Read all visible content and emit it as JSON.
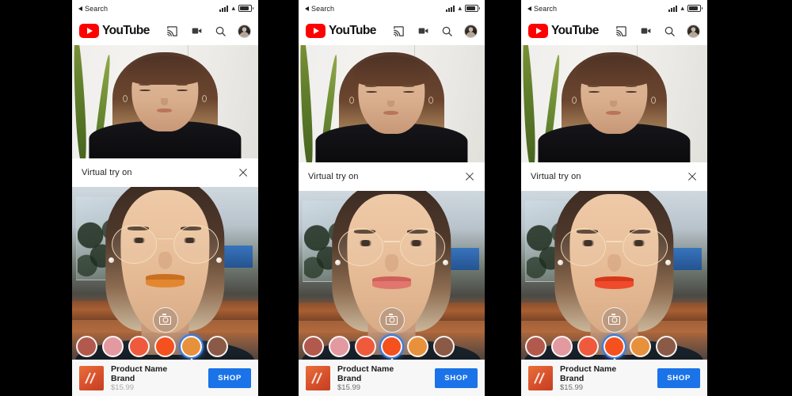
{
  "meta": {
    "background_color": "#000000",
    "accent_blue": "#1a73e8",
    "selection_ring": "#3b7ddd",
    "youtube_red": "#ff0000",
    "panel_count": 3,
    "description": "Three sequential mobile screenshots of a YouTube AR beauty Virtual try on experience"
  },
  "status_bar": {
    "back_label": "Search",
    "signal_icon": "signal-bars-icon",
    "wifi_icon": "wifi-icon",
    "battery_icon": "battery-icon"
  },
  "app_bar": {
    "brand": "YouTube",
    "play_icon": "youtube-play-icon",
    "actions": [
      {
        "name": "cast-icon",
        "label": "Cast"
      },
      {
        "name": "video-camera-icon",
        "label": "Create"
      },
      {
        "name": "search-icon",
        "label": "Search"
      },
      {
        "name": "avatar",
        "label": "Account"
      }
    ]
  },
  "tryon": {
    "title": "Virtual try on",
    "close_icon": "close-icon",
    "shutter_icon": "camera-icon"
  },
  "product": {
    "name": "Product Name",
    "brand": "Brand",
    "price": "$15.99",
    "shop_label": "SHOP",
    "thumb_icon": "lipstick-swatch-thumbnail"
  },
  "swatches": {
    "colors": [
      "#b2594d",
      "#e29aa0",
      "#ef5a3d",
      "#f4511e",
      "#e8913c",
      "#8a5a46"
    ]
  },
  "panels": [
    {
      "id": "panel-1",
      "selected_swatch_index": 4,
      "lip_color": "#e2872f",
      "lip_color_deep": "#c96f20",
      "caption": "Orange shade applied"
    },
    {
      "id": "panel-2",
      "selected_swatch_index": 3,
      "lip_color": "#e1766f",
      "lip_color_deep": "#cf5f58",
      "caption": "Soft coral-pink shade applied"
    },
    {
      "id": "panel-3",
      "selected_swatch_index": 3,
      "lip_color": "#ef4a2c",
      "lip_color_deep": "#d53718",
      "caption": "Vivid red-orange shade applied"
    }
  ]
}
